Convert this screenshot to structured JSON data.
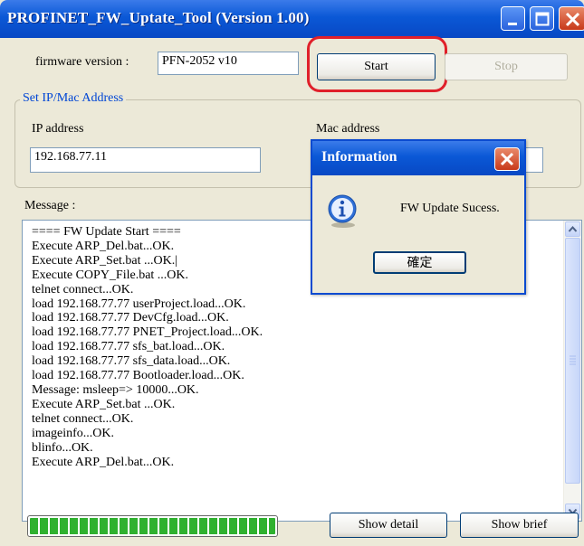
{
  "window": {
    "title": "PROFINET_FW_Uptate_Tool (Version 1.00)"
  },
  "firmware": {
    "label": "firmware version :",
    "value": "PFN-2052 v10"
  },
  "buttons": {
    "start": "Start",
    "stop": "Stop",
    "show_detail": "Show detail",
    "show_brief": "Show brief"
  },
  "group": {
    "title": "Set IP/Mac Address",
    "ip_label": "IP address",
    "ip_value": "192.168.77.11",
    "mac_label": "Mac address",
    "mac_value": ""
  },
  "messages": {
    "label": "Message :",
    "lines": [
      "==== FW Update Start ====",
      "Execute ARP_Del.bat...OK.",
      "Execute ARP_Set.bat ...OK.|",
      "Execute COPY_File.bat ...OK.",
      "telnet connect...OK.",
      "load 192.168.77.77 userProject.load...OK.",
      "load 192.168.77.77 DevCfg.load...OK.",
      "load 192.168.77.77 PNET_Project.load...OK.",
      "load 192.168.77.77 sfs_bat.load...OK.",
      "load 192.168.77.77 sfs_data.load...OK.",
      "load 192.168.77.77 Bootloader.load...OK.",
      "Message: msleep=> 10000...OK.",
      "Execute ARP_Set.bat ...OK.",
      "telnet connect...OK.",
      "imageinfo...OK.",
      "blinfo...OK.",
      "Execute ARP_Del.bat...OK."
    ]
  },
  "progress": {
    "fraction": 1.0,
    "color": "#2fb12f"
  },
  "dialog": {
    "title": "Information",
    "message": "FW Update Sucess.",
    "ok_label": "確定",
    "icon": "info-icon"
  },
  "colors": {
    "titlebar": "#0a58d6",
    "window_bg": "#ece9d8",
    "highlight": "#e0202a",
    "group_title": "#0046d5"
  }
}
